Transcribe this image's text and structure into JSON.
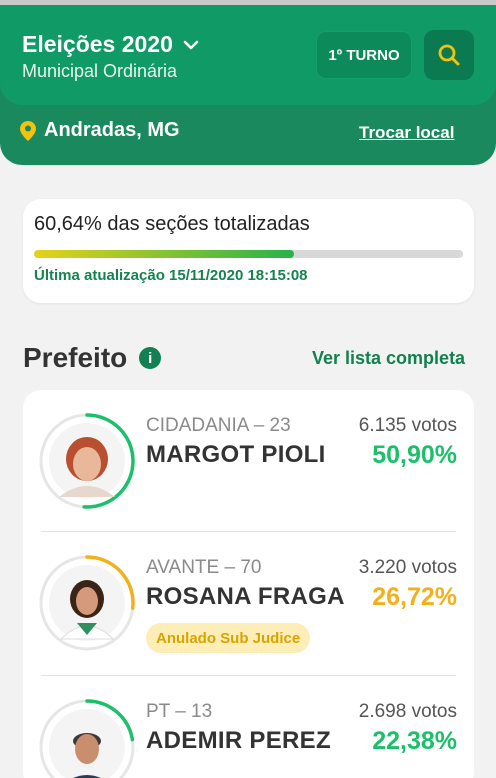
{
  "header": {
    "title": "Eleições 2020",
    "subtitle": "Municipal Ordinária",
    "turno": "1º TURNO",
    "location": "Andradas, MG",
    "change_location": "Trocar local"
  },
  "progress": {
    "title": "60,64% das seções totalizadas",
    "fraction": 0.6064,
    "updated": "Última atualização 15/11/2020 18:15:08"
  },
  "section": {
    "title": "Prefeito",
    "info_icon": "i",
    "see_list": "Ver lista completa"
  },
  "candidates": [
    {
      "party": "CIDADANIA – 23",
      "name": "MARGOT PIOLI",
      "votes": "6.135 votos",
      "percent": "50,90%",
      "share": 0.509,
      "color": "#1cbf6a"
    },
    {
      "party": "AVANTE – 70",
      "name": "ROSANA FRAGA",
      "votes": "3.220 votos",
      "percent": "26,72%",
      "share": 0.2672,
      "color": "#f2b01b",
      "badge": "Anulado Sub Judice"
    },
    {
      "party": "PT – 13",
      "name": "ADEMIR PEREZ",
      "votes": "2.698 votos",
      "percent": "22,38%",
      "share": 0.2238,
      "color": "#1cbf6a"
    }
  ],
  "colors": {
    "brand_green": "#0f9a66",
    "accent_yellow": "#f2b01b",
    "vote_green": "#1cbf6a"
  }
}
